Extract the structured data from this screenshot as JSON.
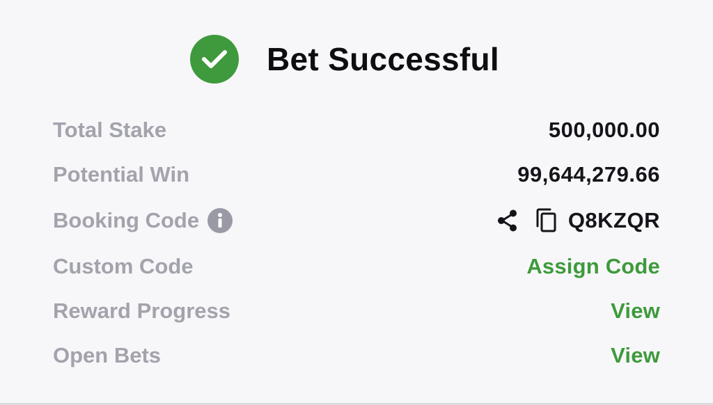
{
  "header": {
    "title": "Bet Successful",
    "icon": "check-circle-icon",
    "accent_color": "#3e9a3c"
  },
  "rows": [
    {
      "label": "Total Stake",
      "value": "500,000.00"
    },
    {
      "label": "Potential Win",
      "value": "99,644,279.66"
    },
    {
      "label": "Booking Code",
      "value": "Q8KZQR",
      "label_icon": "info-icon",
      "actions": [
        "share-icon",
        "copy-icon"
      ]
    },
    {
      "label": "Custom Code",
      "value": "Assign Code"
    },
    {
      "label": "Reward Progress",
      "value": "View"
    },
    {
      "label": "Open Bets",
      "value": "View"
    }
  ],
  "colors": {
    "label": "#a3a3ad",
    "value": "#14141a",
    "link": "#3e9a3c",
    "background": "#f7f7f9"
  }
}
